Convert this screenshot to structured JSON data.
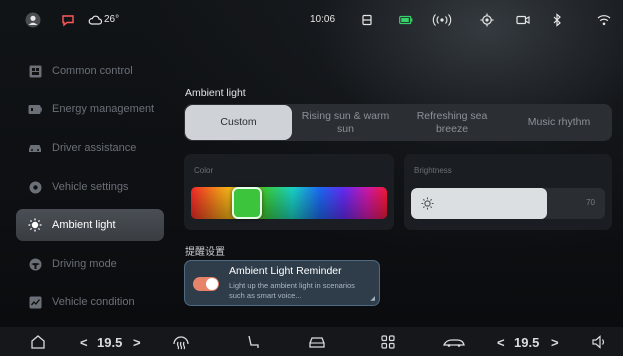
{
  "status_bar": {
    "temperature": "26°",
    "time": "10:06",
    "icons": [
      "avatar-icon",
      "message-icon",
      "cloud-icon",
      "seat-icon",
      "battery-icon",
      "radio-icon",
      "location-icon",
      "camera-icon",
      "bluetooth-icon",
      "wifi-icon"
    ]
  },
  "sidebar": {
    "items": [
      {
        "label": "Common control",
        "icon": "grid-icon"
      },
      {
        "label": "Energy management",
        "icon": "battery-icon"
      },
      {
        "label": "Driver assistance",
        "icon": "car-icon"
      },
      {
        "label": "Vehicle settings",
        "icon": "settings-icon"
      },
      {
        "label": "Ambient light",
        "icon": "light-icon",
        "active": true
      },
      {
        "label": "Driving mode",
        "icon": "steering-icon"
      },
      {
        "label": "Vehicle condition",
        "icon": "condition-icon"
      }
    ]
  },
  "main": {
    "section_title": "Ambient light",
    "tabs": [
      "Custom",
      "Rising sun & warm sun",
      "Refreshing sea breeze",
      "Music rhythm"
    ],
    "active_tab": "Custom",
    "color_label": "Color",
    "brightness_label": "Brightness",
    "brightness_value": "70",
    "brightness_level": 0.7,
    "reminder_section": "提醒设置",
    "reminder": {
      "title": "Ambient Light Reminder",
      "description": "Light up the ambient light in scenarios such as smart voice...",
      "enabled": true
    }
  },
  "bottom_bar": {
    "left_temp": "19.5",
    "right_temp": "19.5",
    "left_decrease": "<",
    "left_increase": ">",
    "right_decrease": "<",
    "right_increase": ">"
  },
  "colors": {
    "accent_toggle": "#e6836a",
    "active_nav": "#43484e",
    "selected_color": "#3cc53c"
  }
}
